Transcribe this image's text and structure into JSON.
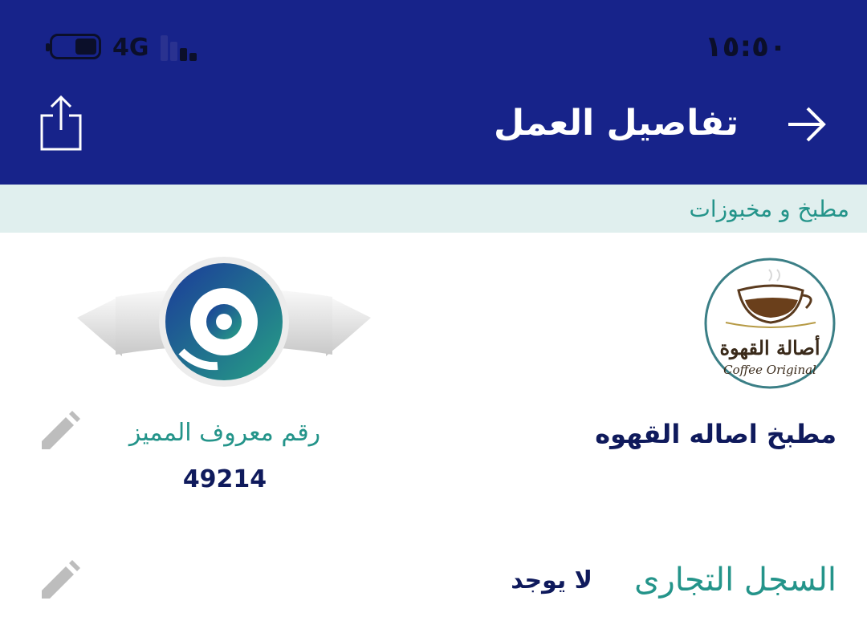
{
  "status_bar": {
    "time": "١٥:٥٠",
    "network": "4G",
    "battery_level": 0.45,
    "signal_bars_active": 2,
    "signal_bars_total": 4
  },
  "header": {
    "title": "تفاصيل العمل",
    "back_icon": "arrow-right-icon",
    "share_icon": "share-icon"
  },
  "category": {
    "label": "مطبخ و مخبوزات"
  },
  "business": {
    "name": "مطبخ اصاله القهوه",
    "logo_text_ar": "أصالة القهوة",
    "logo_text_en": "Coffee Original"
  },
  "maroof": {
    "title": "رقم معروف المميز",
    "number": "49214",
    "logo_icon": "maroof-badge-icon"
  },
  "commercial_register": {
    "label": "السجل التجارى",
    "value": "لا يوجد"
  },
  "colors": {
    "header_bg": "#17238a",
    "category_bg": "#e0efee",
    "accent_green": "#24948a",
    "navy_text": "#0f1a5c",
    "edit_icon": "#bdbdbd"
  }
}
